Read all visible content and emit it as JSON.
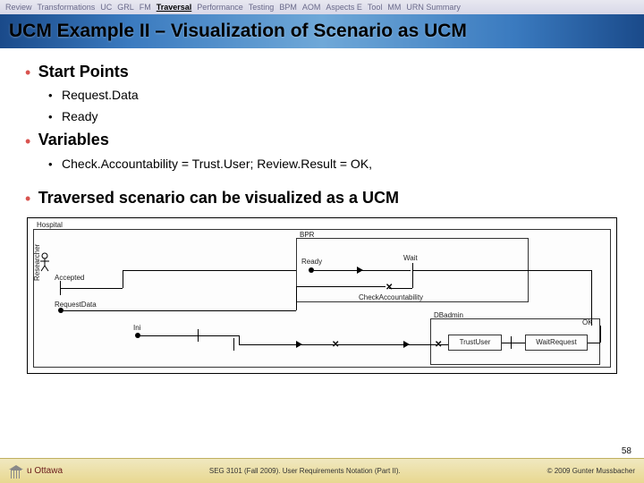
{
  "nav": {
    "items": [
      "Review",
      "Transformations",
      "UC",
      "GRL",
      "FM",
      "Traversal",
      "Performance",
      "Testing",
      "BPM",
      "AOM",
      "Aspects E",
      "Tool",
      "MM",
      "URN Summary"
    ],
    "activeIndex": 5
  },
  "title": "UCM Example II – Visualization of Scenario as UCM",
  "bullets": {
    "startPoints": {
      "label": "Start Points",
      "items": [
        "Request.Data",
        "Ready"
      ]
    },
    "variables": {
      "label": "Variables",
      "items": [
        "Check.Accountability = Trust.User; Review.Result = OK,"
      ]
    },
    "traversed": "Traversed scenario can be visualized as a UCM"
  },
  "diagram": {
    "components": {
      "hospital": "Hospital",
      "bpr": "BPR",
      "dbadmin": "DBadmin"
    },
    "actorLabel": "Researcher",
    "nodes": {
      "accepted": "Accepted",
      "requestData": "RequestData",
      "ini": "Ini",
      "ready": "Ready",
      "wait": "Wait",
      "checkAccount": "CheckAccountability",
      "trustUser": "TrustUser",
      "waitRequest": "WaitRequest",
      "ok": "OK"
    }
  },
  "footer": {
    "logoText": "u Ottawa",
    "center": "SEG 3101 (Fall 2009).   User Requirements Notation (Part II).",
    "right": "© 2009 Gunter Mussbacher"
  },
  "pageNumber": "58"
}
